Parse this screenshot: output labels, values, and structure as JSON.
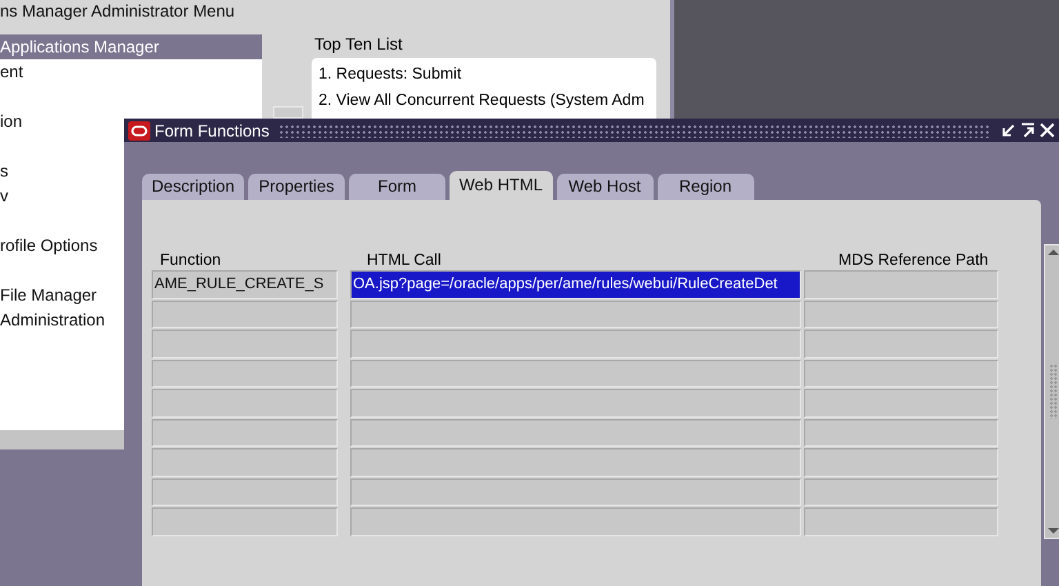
{
  "back_window": {
    "title": "ns Manager Administrator Menu",
    "menu_items": [
      {
        "label": "Applications Manager",
        "selected": true
      },
      {
        "label": "ent",
        "selected": false
      },
      {
        "label": "ion",
        "selected": false
      },
      {
        "label": "s",
        "selected": false
      },
      {
        "label": "v",
        "selected": false
      },
      {
        "label": "rofile Options",
        "selected": false
      },
      {
        "label": "File Manager",
        "selected": false
      },
      {
        "label": "Administration",
        "selected": false
      }
    ],
    "top_ten": {
      "title": "Top Ten List",
      "items": [
        "1. Requests: Submit",
        "2. View All Concurrent Requests (System Adm"
      ]
    }
  },
  "form_window": {
    "title": "Form Functions",
    "tabs": [
      {
        "label": "Description",
        "selected": false
      },
      {
        "label": "Properties",
        "selected": false
      },
      {
        "label": "Form",
        "selected": false
      },
      {
        "label": "Web HTML",
        "selected": true
      },
      {
        "label": "Web Host",
        "selected": false
      },
      {
        "label": "Region",
        "selected": false
      }
    ],
    "table": {
      "columns": [
        "Function",
        "HTML Call",
        "MDS Reference Path"
      ],
      "rows": [
        {
          "function": "AME_RULE_CREATE_S",
          "html_call": "OA.jsp?page=/oracle/apps/per/ame/rules/webui/RuleCreateDet",
          "selected": true
        },
        {
          "selected": false
        },
        {
          "selected": false
        },
        {
          "selected": false
        },
        {
          "selected": false
        },
        {
          "selected": false
        },
        {
          "selected": false
        },
        {
          "selected": false
        },
        {
          "selected": false
        }
      ]
    }
  }
}
